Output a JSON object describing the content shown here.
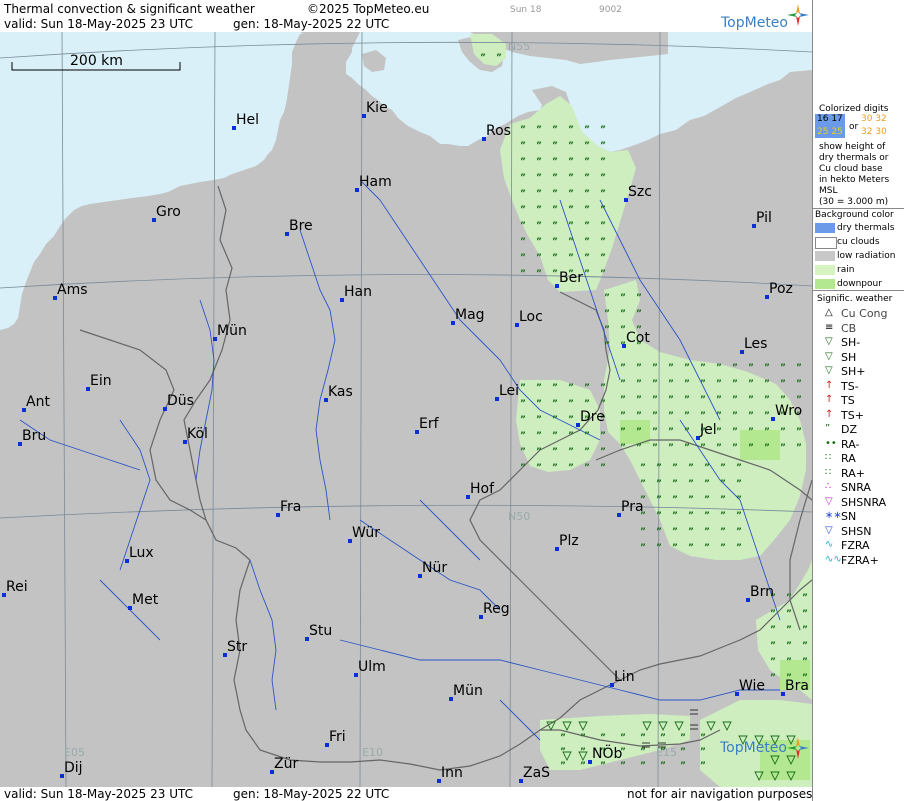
{
  "header": {
    "title": "Thermal convection & significant weather",
    "copyright": "©2025 TopMeteo.eu",
    "day_code": "Sun 18",
    "code": "9002",
    "valid": "valid:  Sun  18-May-2025  23 UTC",
    "gen": "gen: 18-May-2025 22 UTC",
    "logo": "TopMeteo"
  },
  "map": {
    "scale_label": "200 km",
    "grid_labels": [
      "N55",
      "N50",
      "E05",
      "E10",
      "E15"
    ],
    "cities": [
      "Hel",
      "Kie",
      "Ros",
      "Ham",
      "Szc",
      "Gro",
      "Bre",
      "Pil",
      "Ams",
      "Han",
      "Ber",
      "Poz",
      "Mag",
      "Loc",
      "Mün",
      "Cot",
      "Les",
      "Ein",
      "Kas",
      "Ant",
      "Düs",
      "Lei",
      "Wro",
      "Bru",
      "Köl",
      "Erf",
      "Dre",
      "Jel",
      "Hof",
      "Fra",
      "Pra",
      "Wür",
      "Lux",
      "Plz",
      "Nür",
      "Rei",
      "Met",
      "Reg",
      "Brn",
      "Stu",
      "Str",
      "Ulm",
      "Lin",
      "Wie",
      "Bra",
      "Mün",
      "Fri",
      "NÖb",
      "Dij",
      "Zür",
      "Inn",
      "ZaS"
    ],
    "footer_logo": "TopMeteo"
  },
  "footer": {
    "valid": "valid:  Sun  18-May-2025  23 UTC",
    "gen": "gen: 18-May-2025 22 UTC",
    "disclaimer": "not for air navigation purposes"
  },
  "legend": {
    "colorized_title": "Colorized digits",
    "sample1a": "16 17",
    "sample1b": "25 25",
    "or": "or",
    "sample2a": "30 32",
    "sample2b": "32 30",
    "desc1": "show height of",
    "desc2": "dry thermals or",
    "desc3": "Cu cloud base",
    "desc4": "in hekto Meters",
    "desc5": "MSL",
    "desc6": "(30 = 3.000 m)",
    "bg_title": "Background color",
    "bg_items": [
      "dry thermals",
      "cu clouds",
      "low radiation",
      "rain",
      "downpour"
    ],
    "bg_colors": [
      "#6b9be8",
      "#ffffff",
      "#c8c8c8",
      "#d8f3c2",
      "#b4e890"
    ],
    "sig_title": "Signific. weather",
    "sig_items": [
      "Cu Cong",
      "CB",
      "SH-",
      "SH",
      "SH+",
      "TS-",
      "TS",
      "TS+",
      "DZ",
      "RA-",
      "RA",
      "RA+",
      "SNRA",
      "SHSNRA",
      "SN",
      "SHSN",
      "FZRA",
      "FZRA+"
    ],
    "colors": {
      "sea": "#d9f0f8",
      "land": "#c3c3c3",
      "rain": "#cfeec0",
      "downpour": "#b4e890",
      "city": "#0a2fd6",
      "river": "#2a54c8",
      "border": "#666666"
    }
  }
}
